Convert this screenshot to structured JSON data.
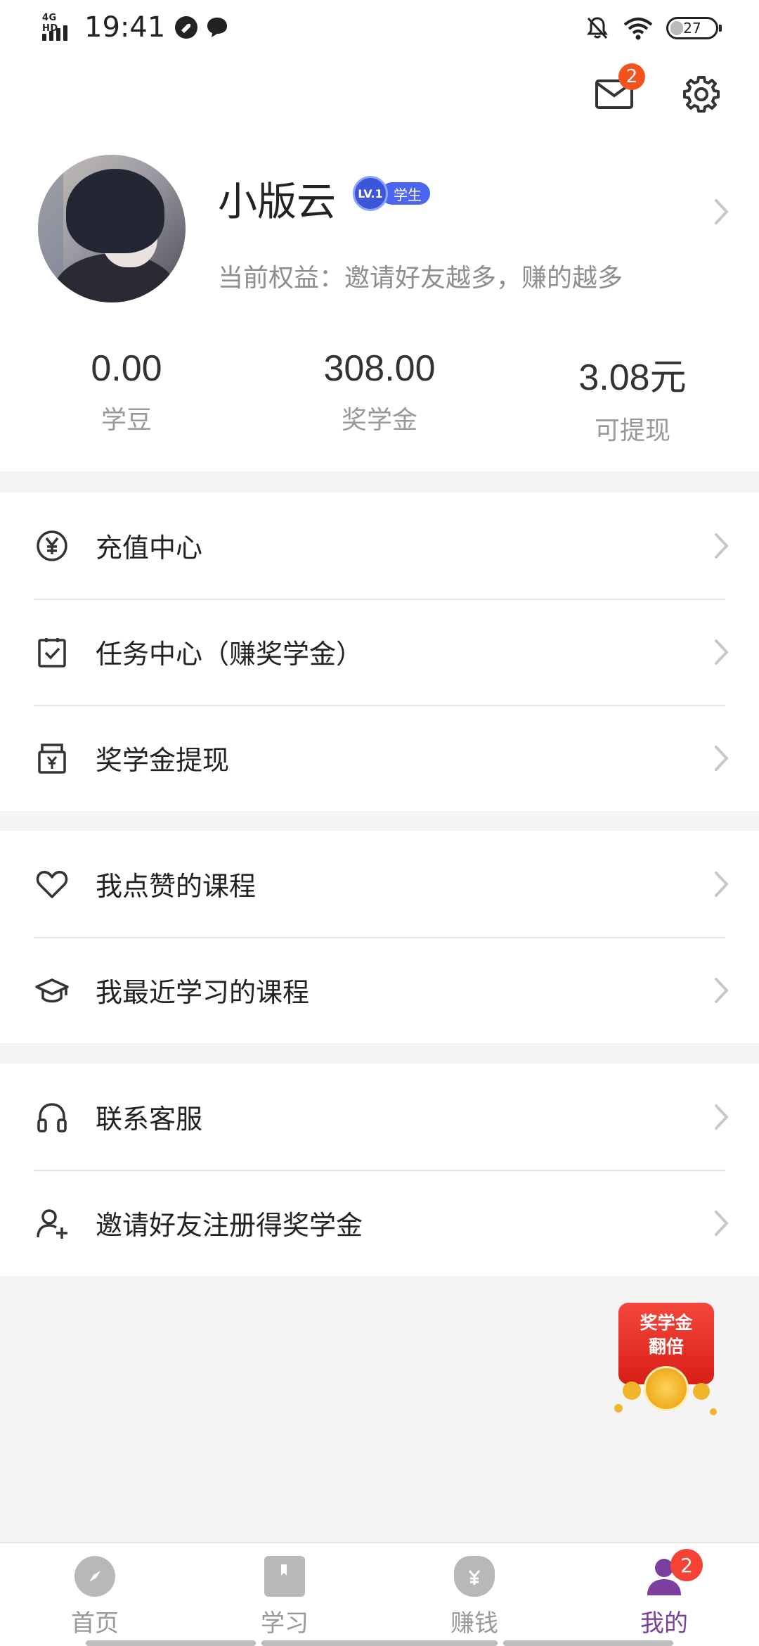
{
  "status_bar": {
    "network": "4G HD",
    "time": "19:41",
    "battery": "27",
    "battery_level": 0.27
  },
  "header": {
    "mail_badge": "2"
  },
  "profile": {
    "name": "小版云",
    "level": "LV.1",
    "role": "学生",
    "privilege": "当前权益：邀请好友越多，赚的越多"
  },
  "stats": [
    {
      "value": "0.00",
      "label": "学豆"
    },
    {
      "value": "308.00",
      "label": "奖学金"
    },
    {
      "value": "3.08元",
      "label": "可提现"
    }
  ],
  "menu_groups": [
    {
      "items": [
        {
          "label": "充值中心",
          "icon": "yuan-coin-icon"
        },
        {
          "label": "任务中心（赚奖学金）",
          "icon": "clipboard-check-icon"
        },
        {
          "label": "奖学金提现",
          "icon": "wallet-yuan-icon"
        }
      ]
    },
    {
      "items": [
        {
          "label": "我点赞的课程",
          "icon": "heart-icon"
        },
        {
          "label": "我最近学习的课程",
          "icon": "graduation-cap-icon"
        }
      ]
    },
    {
      "items": [
        {
          "label": "联系客服",
          "icon": "headphones-icon"
        },
        {
          "label": "邀请好友注册得奖学金",
          "icon": "add-user-icon"
        }
      ]
    }
  ],
  "promo": {
    "line1": "奖学金",
    "line2": "翻倍"
  },
  "tabbar": {
    "tabs": [
      {
        "label": "首页",
        "icon": "compass-icon"
      },
      {
        "label": "学习",
        "icon": "book-icon"
      },
      {
        "label": "赚钱",
        "icon": "money-bag-icon"
      },
      {
        "label": "我的",
        "icon": "person-icon"
      }
    ],
    "me_badge": "2",
    "active_color": "#7b3fa0"
  }
}
